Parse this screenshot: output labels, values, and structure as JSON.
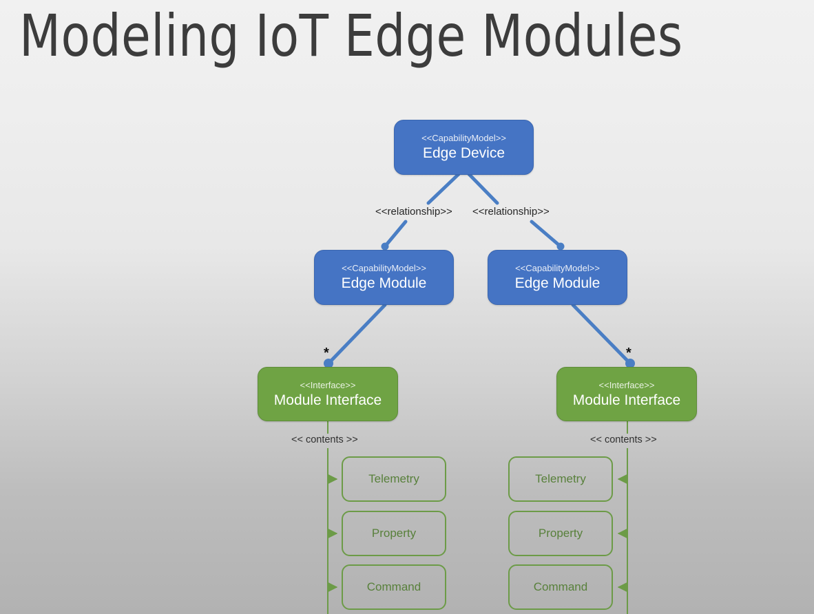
{
  "slide": {
    "title": "Modeling IoT Edge Modules",
    "background_top_color": "#f1f1f1",
    "background_bottom_color": "#b2b2b2"
  },
  "colors": {
    "capability_model_fill": "#4574c4",
    "capability_model_border": "#3a66b0",
    "interface_fill": "#6fa344",
    "interface_border": "#5e8c39",
    "connector_blue": "#4a7ec4",
    "connector_green": "#6c9b47",
    "member_text": "#58803b",
    "title_text": "#3c3c3c"
  },
  "diagram": {
    "type": "uml-class-diagram",
    "nodes": [
      {
        "id": "edge-device",
        "stereotype": "<<CapabilityModel>>",
        "name": "Edge Device",
        "kind": "capability-model"
      },
      {
        "id": "edge-module-left",
        "stereotype": "<<CapabilityModel>>",
        "name": "Edge Module",
        "kind": "capability-model"
      },
      {
        "id": "edge-module-right",
        "stereotype": "<<CapabilityModel>>",
        "name": "Edge Module",
        "kind": "capability-model"
      },
      {
        "id": "module-interface-left",
        "stereotype": "<<Interface>>",
        "name": "Module Interface",
        "kind": "interface"
      },
      {
        "id": "module-interface-right",
        "stereotype": "<<Interface>>",
        "name": "Module Interface",
        "kind": "interface"
      }
    ],
    "edge_labels": {
      "relationship_left": "<<relationship>>",
      "relationship_right": "<<relationship>>",
      "multiplicity_left": "*",
      "multiplicity_right": "*",
      "contents_left": "<< contents >>",
      "contents_right": "<< contents >>"
    },
    "members_left": [
      {
        "label": "Telemetry"
      },
      {
        "label": "Property"
      },
      {
        "label": "Command"
      }
    ],
    "members_right": [
      {
        "label": "Telemetry"
      },
      {
        "label": "Property"
      },
      {
        "label": "Command"
      }
    ]
  }
}
